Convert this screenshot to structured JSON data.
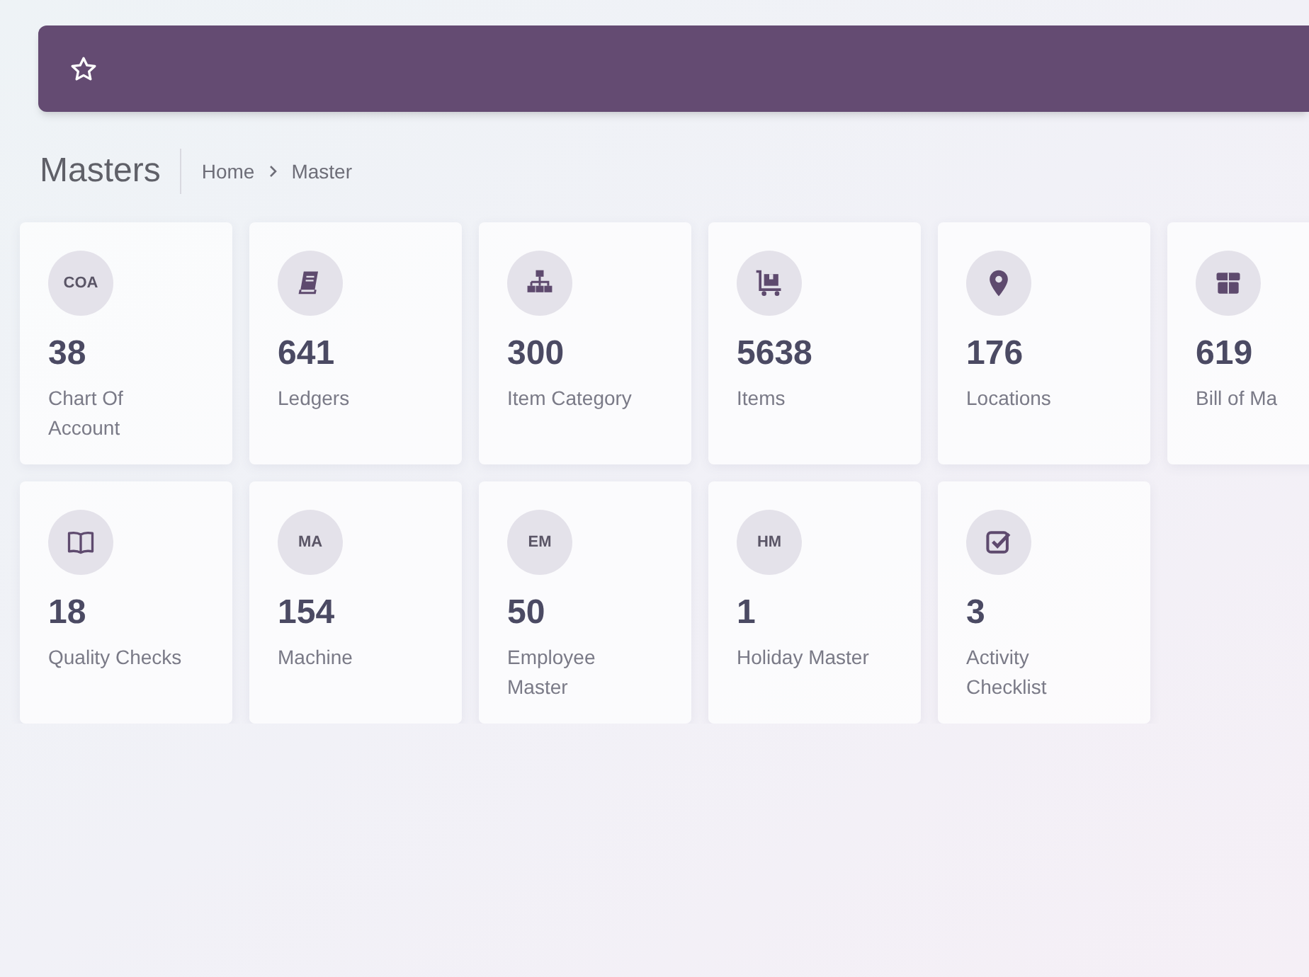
{
  "page_title": "Masters",
  "breadcrumb": [
    "Home",
    "Master"
  ],
  "cards": [
    {
      "kind": "initials",
      "initials": "COA",
      "count": "38",
      "label": "Chart Of Account"
    },
    {
      "kind": "icon",
      "count": "641",
      "label": "Ledgers"
    },
    {
      "kind": "icon",
      "count": "300",
      "label": "Item Category"
    },
    {
      "kind": "icon",
      "count": "5638",
      "label": "Items"
    },
    {
      "kind": "icon",
      "count": "176",
      "label": "Locations"
    },
    {
      "kind": "icon",
      "count": "619",
      "label": "Bill of Ma"
    },
    {
      "kind": "icon",
      "count": "18",
      "label": "Quality Checks"
    },
    {
      "kind": "initials",
      "initials": "MA",
      "count": "154",
      "label": "Machine"
    },
    {
      "kind": "initials",
      "initials": "EM",
      "count": "50",
      "label": "Employee Master"
    },
    {
      "kind": "initials",
      "initials": "HM",
      "count": "1",
      "label": "Holiday Master"
    },
    {
      "kind": "icon",
      "count": "3",
      "label": "Activity Checklist"
    }
  ]
}
